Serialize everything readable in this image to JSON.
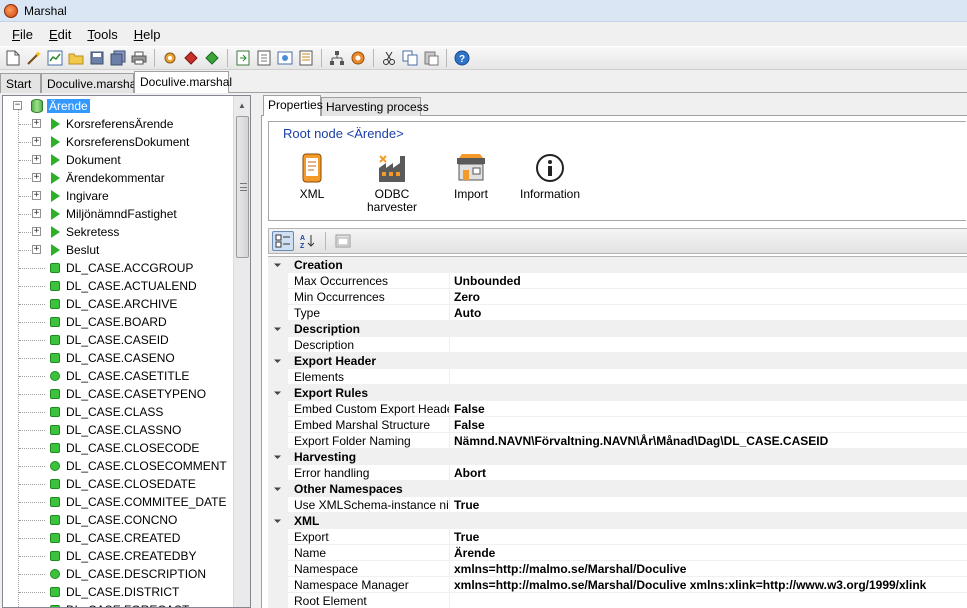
{
  "window": {
    "title": "Marshal"
  },
  "menu": [
    "File",
    "Edit",
    "Tools",
    "Help"
  ],
  "toolbar": {
    "icons": [
      "new-file-icon",
      "wand-icon",
      "chart-icon",
      "open-folder-icon",
      "save-icon",
      "save-all-icon",
      "print-icon",
      "gear-settings-icon",
      "run-red-icon",
      "run-green-icon",
      "export-icon",
      "import-icon",
      "image-icon",
      "list-icon",
      "hierarchy-icon",
      "plugin-icon",
      "cut-icon",
      "copy-icon",
      "paste-icon",
      "help-icon"
    ]
  },
  "doc_tabs": [
    "Start",
    "Doculive.marshal",
    "Doculive.marshal"
  ],
  "tree": {
    "root": "Ärende",
    "children": [
      {
        "label": "KorsreferensÄrende",
        "icon": "triangle"
      },
      {
        "label": "KorsreferensDokument",
        "icon": "triangle"
      },
      {
        "label": "Dokument",
        "icon": "triangle"
      },
      {
        "label": "Ärendekommentar",
        "icon": "triangle"
      },
      {
        "label": "Ingivare",
        "icon": "triangle"
      },
      {
        "label": "MiljönämndFastighet",
        "icon": "triangle"
      },
      {
        "label": "Sekretess",
        "icon": "triangle"
      },
      {
        "label": "Beslut",
        "icon": "triangle"
      },
      {
        "label": "DL_CASE.ACCGROUP",
        "icon": "square"
      },
      {
        "label": "DL_CASE.ACTUALEND",
        "icon": "square"
      },
      {
        "label": "DL_CASE.ARCHIVE",
        "icon": "square"
      },
      {
        "label": "DL_CASE.BOARD",
        "icon": "square"
      },
      {
        "label": "DL_CASE.CASEID",
        "icon": "square"
      },
      {
        "label": "DL_CASE.CASENO",
        "icon": "square"
      },
      {
        "label": "DL_CASE.CASETITLE",
        "icon": "circle"
      },
      {
        "label": "DL_CASE.CASETYPENO",
        "icon": "square"
      },
      {
        "label": "DL_CASE.CLASS",
        "icon": "square"
      },
      {
        "label": "DL_CASE.CLASSNO",
        "icon": "square"
      },
      {
        "label": "DL_CASE.CLOSECODE",
        "icon": "square"
      },
      {
        "label": "DL_CASE.CLOSECOMMENT",
        "icon": "circle"
      },
      {
        "label": "DL_CASE.CLOSEDATE",
        "icon": "square"
      },
      {
        "label": "DL_CASE.COMMITEE_DATE",
        "icon": "square"
      },
      {
        "label": "DL_CASE.CONCNO",
        "icon": "square"
      },
      {
        "label": "DL_CASE.CREATED",
        "icon": "square"
      },
      {
        "label": "DL_CASE.CREATEDBY",
        "icon": "square"
      },
      {
        "label": "DL_CASE.DESCRIPTION",
        "icon": "circle"
      },
      {
        "label": "DL_CASE.DISTRICT",
        "icon": "square"
      },
      {
        "label": "DL_CASE.FORECAST",
        "icon": "square"
      }
    ]
  },
  "right_tabs": [
    "Properties",
    "Harvesting process"
  ],
  "root_node": {
    "title": "Root node <Ärende>",
    "actions": [
      {
        "label": "XML",
        "icon": "xml-icon"
      },
      {
        "label": "ODBC harvester",
        "icon": "odbc-harvester-icon"
      },
      {
        "label": "Import",
        "icon": "import-icon"
      },
      {
        "label": "Information",
        "icon": "information-icon"
      }
    ]
  },
  "prop_toolbar": [
    "categorized-icon",
    "alphabetical-sort-icon",
    "property-pages-icon"
  ],
  "properties": [
    {
      "category": "Creation",
      "items": [
        {
          "name": "Max Occurrences",
          "value": "Unbounded"
        },
        {
          "name": "Min Occurrences",
          "value": "Zero"
        },
        {
          "name": "Type",
          "value": "Auto"
        }
      ]
    },
    {
      "category": "Description",
      "items": [
        {
          "name": "Description",
          "value": ""
        }
      ]
    },
    {
      "category": "Export Header",
      "items": [
        {
          "name": "Elements",
          "value": ""
        }
      ]
    },
    {
      "category": "Export Rules",
      "items": [
        {
          "name": "Embed Custom Export Header",
          "value": "False"
        },
        {
          "name": "Embed Marshal Structure",
          "value": "False"
        },
        {
          "name": "Export Folder Naming",
          "value": "Nämnd.NAVN\\Förvaltning.NAVN\\År\\Månad\\Dag\\DL_CASE.CASEID"
        }
      ]
    },
    {
      "category": "Harvesting",
      "items": [
        {
          "name": "Error handling",
          "value": "Abort"
        }
      ]
    },
    {
      "category": "Other Namespaces",
      "items": [
        {
          "name": "Use XMLSchema-instance nil",
          "value": "True"
        }
      ]
    },
    {
      "category": "XML",
      "items": [
        {
          "name": "Export",
          "value": "True"
        },
        {
          "name": "Name",
          "value": "Ärende"
        },
        {
          "name": "Namespace",
          "value": "xmlns=http://malmo.se/Marshal/Doculive"
        },
        {
          "name": "Namespace Manager",
          "value": "xmlns=http://malmo.se/Marshal/Doculive xmlns:xlink=http://www.w3.org/1999/xlink"
        },
        {
          "name": "Root Element",
          "value": ""
        }
      ]
    }
  ]
}
